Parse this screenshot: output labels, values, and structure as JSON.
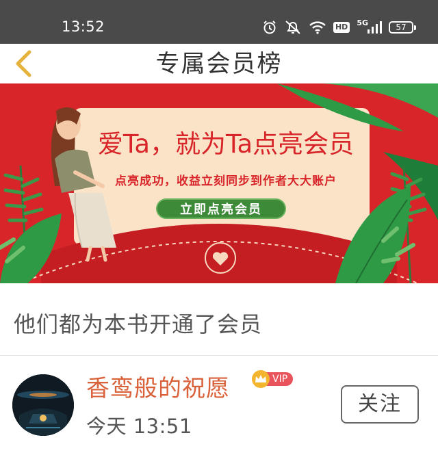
{
  "status_bar": {
    "time": "13:52",
    "icons": [
      "alarm-icon",
      "mute-icon",
      "wifi-icon",
      "hd-icon",
      "signal-5g-icon",
      "battery-icon"
    ],
    "hd_label": "HD",
    "network_label": "5G",
    "battery_level": "57"
  },
  "header": {
    "title": "专属会员榜",
    "back_icon": "chevron-left-icon",
    "accent_color": "#e5b23b"
  },
  "banner": {
    "headline": "爱Ta，就为Ta点亮会员",
    "subtitle": "点亮成功，收益立刻同步到作者大大账户",
    "cta_label": "立即点亮会员",
    "background_color": "#d8252a",
    "cta_color": "#3d8a39"
  },
  "section": {
    "title": "他们都为本书开通了会员"
  },
  "members": [
    {
      "name": "香鸾般的祝愿",
      "badge": "VIP",
      "time": "今天 13:51",
      "follow_label": "关注",
      "name_color": "#d9623b"
    }
  ]
}
